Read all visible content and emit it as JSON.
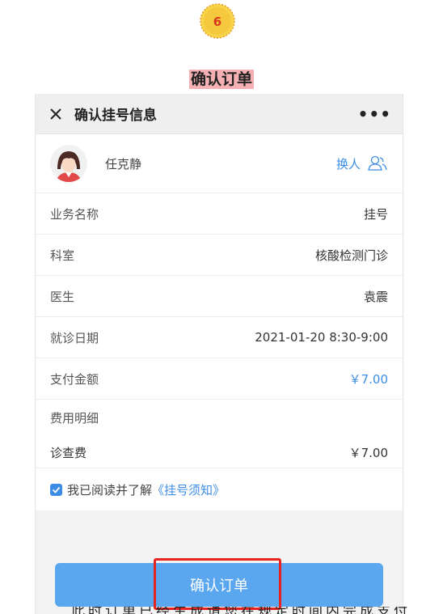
{
  "step": {
    "number": "6",
    "title": "确认订单"
  },
  "navbar": {
    "title": "确认挂号信息",
    "more": "•••"
  },
  "patient": {
    "name": "任克静",
    "switch_label": "换人"
  },
  "rows": [
    {
      "label": "业务名称",
      "value": "挂号"
    },
    {
      "label": "科室",
      "value": "核酸检测门诊"
    },
    {
      "label": "医生",
      "value": "袁震"
    },
    {
      "label": "就诊日期",
      "value": "2021-01-20 8:30-9:00"
    },
    {
      "label": "支付金额",
      "value": "￥7.00"
    }
  ],
  "fees": {
    "title": "费用明细",
    "items": [
      {
        "label": "诊查费",
        "value": "￥7.00"
      }
    ]
  },
  "agreement": {
    "text": "我已阅读并了解",
    "link": "《挂号须知》",
    "checked": true
  },
  "confirm_label": "确认订单",
  "bottom_text": "此时订单已经生成请您在规定时间内完成支付",
  "colors": {
    "accent": "#3d8ce6",
    "button": "#5ba7ef",
    "highlight": "#e8221e",
    "title_bg": "#f4b0b3"
  }
}
